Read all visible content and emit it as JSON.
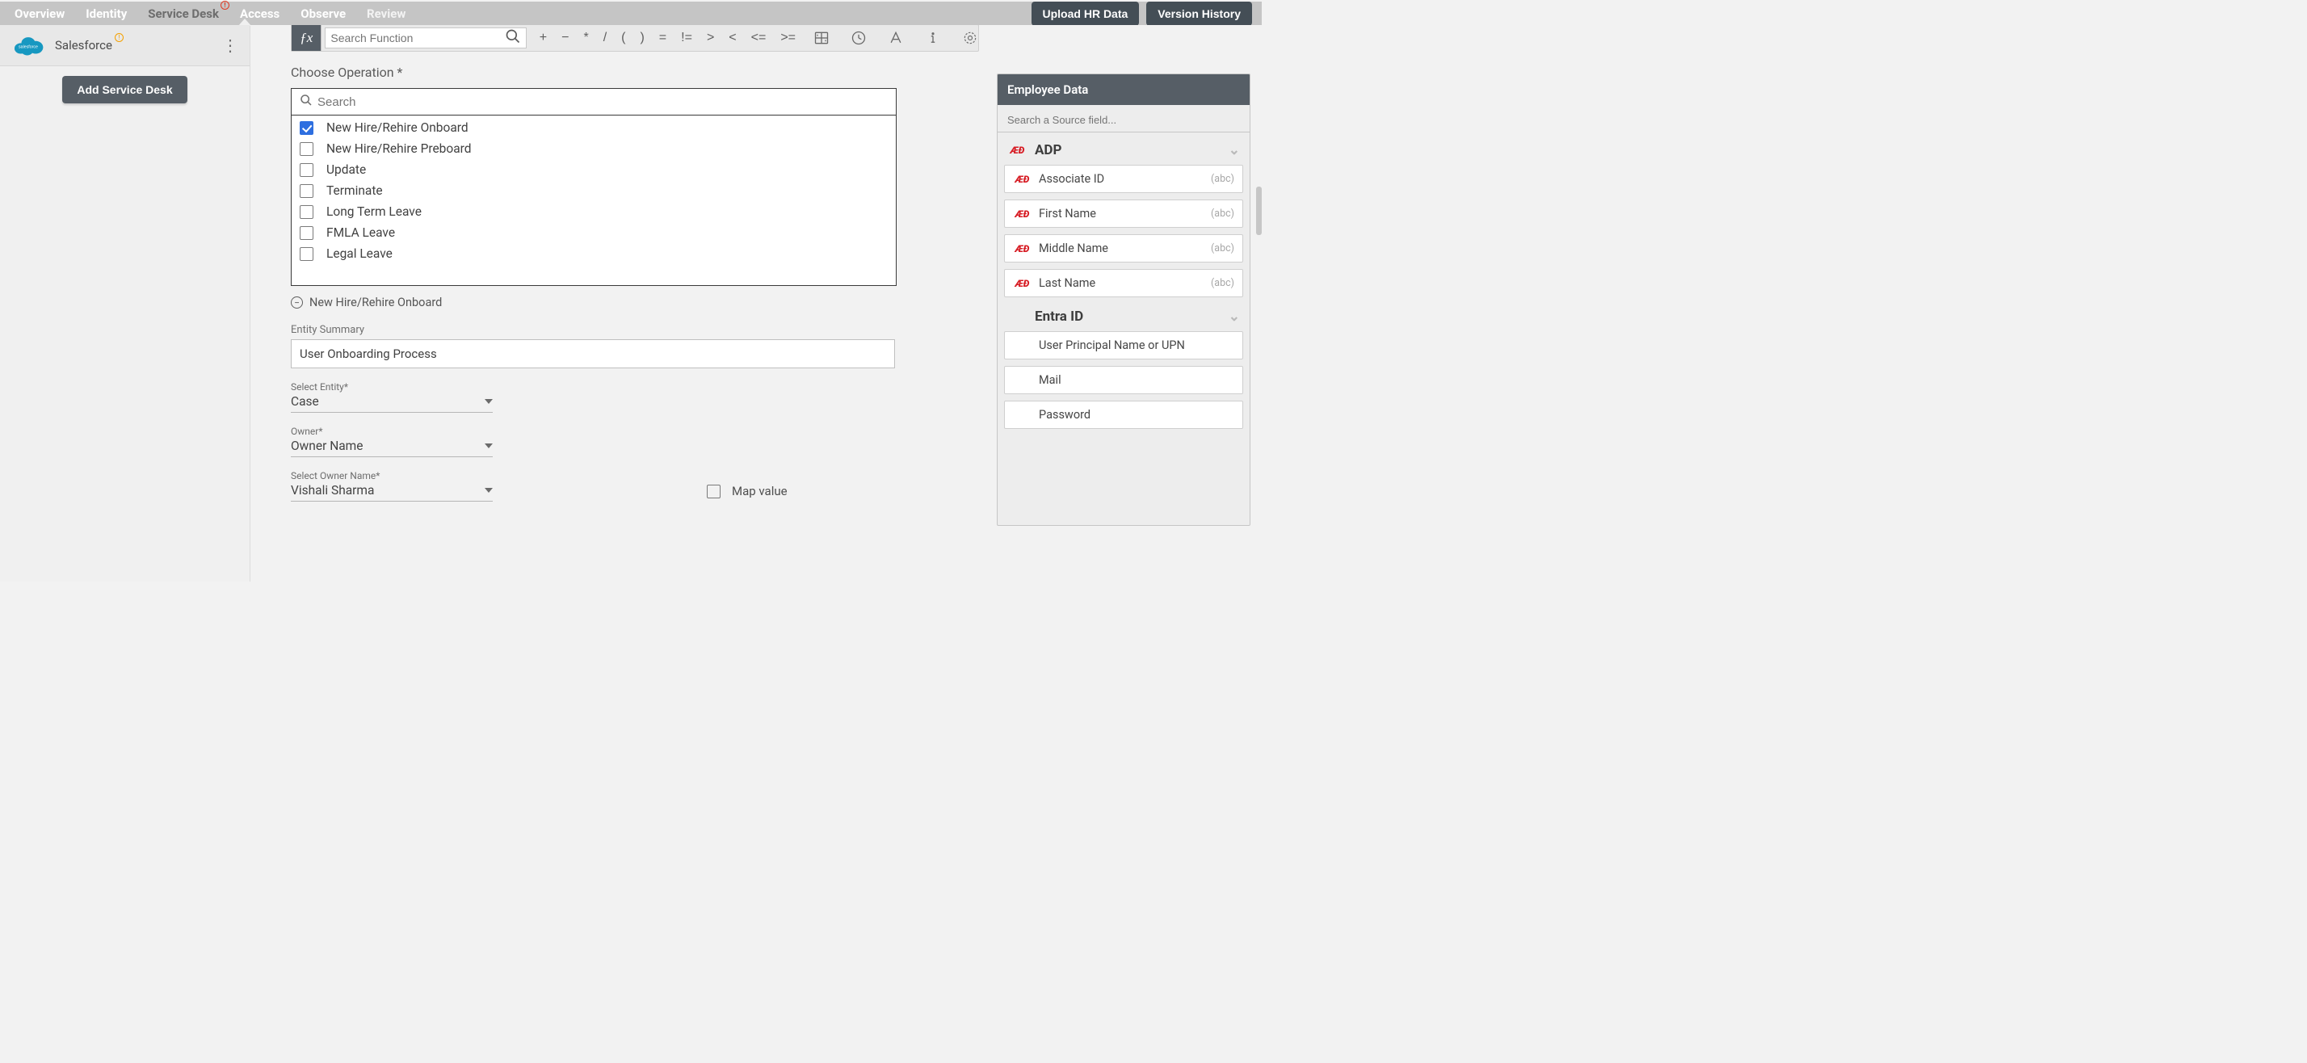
{
  "topnav": {
    "tabs": [
      {
        "label": "Overview"
      },
      {
        "label": "Identity"
      },
      {
        "label": "Service Desk",
        "active": true,
        "warn": true
      },
      {
        "label": "Access"
      },
      {
        "label": "Observe"
      },
      {
        "label": "Review",
        "disabled": true
      }
    ],
    "upload_btn": "Upload HR Data",
    "version_btn": "Version History"
  },
  "sidebar": {
    "items": [
      {
        "label": "Salesforce",
        "warn": true
      }
    ],
    "add_btn": "Add Service Desk"
  },
  "formula": {
    "search_placeholder": "Search Function",
    "operators": [
      "+",
      "−",
      "*",
      "/",
      "(",
      ")",
      "=",
      "!=",
      ">",
      "<",
      "<=",
      ">="
    ]
  },
  "operation": {
    "title": "Choose Operation *",
    "search_placeholder": "Search",
    "options": [
      {
        "label": "New Hire/Rehire Onboard",
        "checked": true
      },
      {
        "label": "New Hire/Rehire Preboard",
        "checked": false
      },
      {
        "label": "Update",
        "checked": false
      },
      {
        "label": "Terminate",
        "checked": false
      },
      {
        "label": "Long Term Leave",
        "checked": false
      },
      {
        "label": "FMLA Leave",
        "checked": false
      },
      {
        "label": "Legal Leave",
        "checked": false
      }
    ],
    "chip": "New Hire/Rehire Onboard"
  },
  "entity_summary": {
    "label": "Entity Summary",
    "value": "User Onboarding Process"
  },
  "selects": [
    {
      "label": "Select Entity*",
      "value": "Case"
    },
    {
      "label": "Owner*",
      "value": "Owner Name"
    },
    {
      "label": "Select Owner Name*",
      "value": "Vishali Sharma"
    }
  ],
  "map_value_label": "Map value",
  "employee_panel": {
    "title": "Employee Data",
    "search_placeholder": "Search a Source field...",
    "sources": [
      {
        "name": "ADP",
        "logo": "adp",
        "fields": [
          {
            "label": "Associate ID",
            "type": "(abc)"
          },
          {
            "label": "First Name",
            "type": "(abc)"
          },
          {
            "label": "Middle Name",
            "type": "(abc)"
          },
          {
            "label": "Last Name",
            "type": "(abc)"
          }
        ]
      },
      {
        "name": "Entra ID",
        "logo": "entra",
        "fields": [
          {
            "label": "User Principal Name or UPN",
            "type": ""
          },
          {
            "label": "Mail",
            "type": ""
          },
          {
            "label": "Password",
            "type": ""
          }
        ]
      }
    ]
  }
}
